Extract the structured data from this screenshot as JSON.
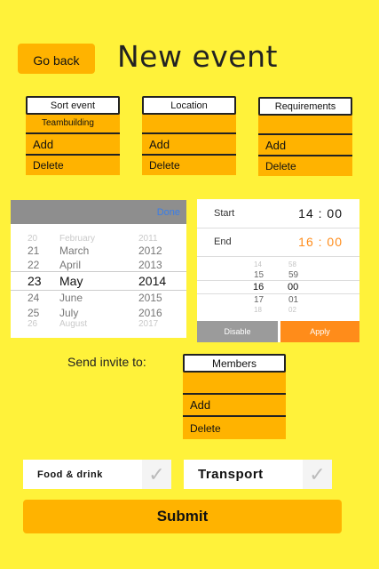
{
  "header": {
    "back_label": "Go back",
    "title": "New event"
  },
  "columns": [
    {
      "head": "Sort event",
      "first": "Teambuilding",
      "add": "Add",
      "delete": "Delete"
    },
    {
      "head": "Location",
      "first": "",
      "add": "Add",
      "delete": "Delete"
    },
    {
      "head": "Requirements",
      "first": "",
      "add": "Add",
      "delete": "Delete"
    }
  ],
  "date_picker": {
    "done_label": "Done",
    "rows": [
      {
        "d": "20",
        "m": "February",
        "y": "2011"
      },
      {
        "d": "21",
        "m": "March",
        "y": "2012"
      },
      {
        "d": "22",
        "m": "April",
        "y": "2013"
      },
      {
        "d": "23",
        "m": "May",
        "y": "2014"
      },
      {
        "d": "24",
        "m": "June",
        "y": "2015"
      },
      {
        "d": "25",
        "m": "July",
        "y": "2016"
      },
      {
        "d": "26",
        "m": "August",
        "y": "2017"
      }
    ]
  },
  "time_picker": {
    "start_label": "Start",
    "start_value": "14 : 00",
    "end_label": "End",
    "end_value": "16 : 00",
    "hours": [
      "14",
      "15",
      "16",
      "17",
      "18"
    ],
    "minutes": [
      "58",
      "59",
      "00",
      "01",
      "02"
    ],
    "disable_label": "Disable",
    "apply_label": "Apply",
    "end_color": "#ff8c1a"
  },
  "invite": {
    "label": "Send invite to:",
    "members": {
      "head": "Members",
      "first": "",
      "add": "Add",
      "delete": "Delete"
    }
  },
  "options": [
    {
      "label": "Food & drink",
      "check_icon": "checkmark-icon"
    },
    {
      "label": "Transport",
      "check_icon": "checkmark-icon"
    }
  ],
  "submit_label": "Submit",
  "colors": {
    "background": "#fff23a",
    "accent": "#ffb300",
    "apply": "#ff8c1a",
    "disable": "#9b9b9b"
  }
}
